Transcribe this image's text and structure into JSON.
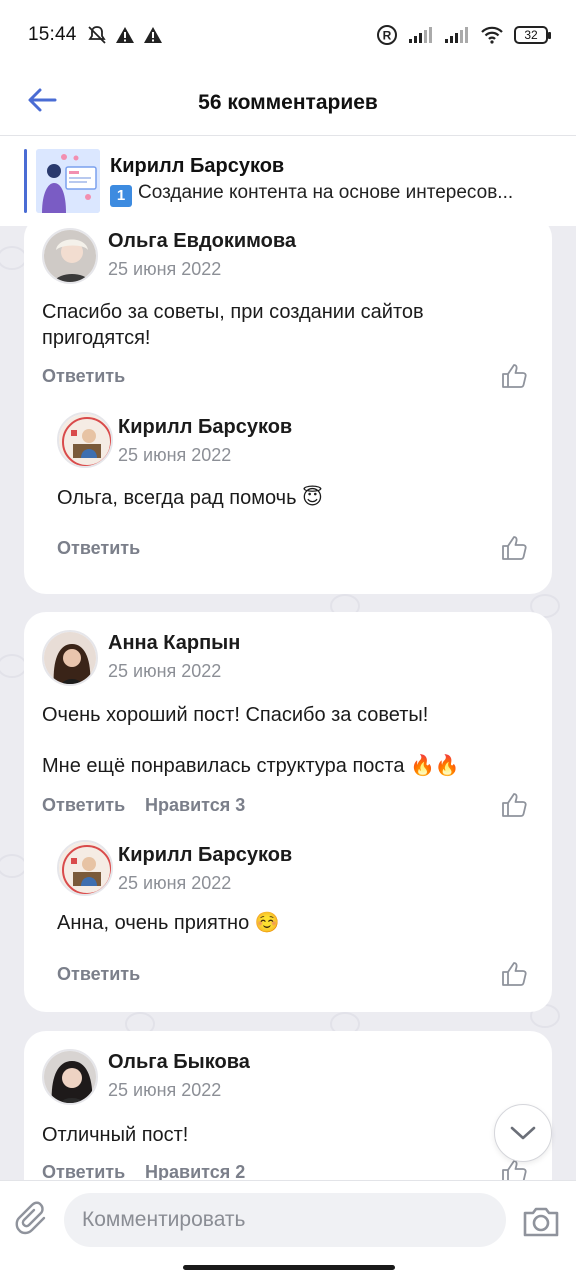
{
  "status_bar": {
    "time": "15:44",
    "battery": "32",
    "icons": [
      "mute-icon",
      "warning-icon",
      "warning-icon",
      "registered-icon",
      "signal-icon",
      "signal-icon",
      "wifi-icon",
      "battery-icon"
    ]
  },
  "header": {
    "title": "56 комментариев",
    "back_icon": "back-arrow-icon"
  },
  "post": {
    "author": "Кирилл Барсуков",
    "badge": "1",
    "snippet": "Создание контента на основе интересов..."
  },
  "threads": [
    {
      "comment": {
        "author": "Ольга Евдокимова",
        "date": "25 июня 2022",
        "text": "Спасибо за советы, при создании сайтов пригодятся!",
        "reply_label": "Ответить"
      },
      "reply": {
        "author": "Кирилл Барсуков",
        "date": "25 июня 2022",
        "text": "Ольга, всегда рад помочь 😇",
        "reply_label": "Ответить"
      }
    },
    {
      "comment": {
        "author": "Анна Карпын",
        "date": "25 июня 2022",
        "text_line1": "Очень хороший пост! Спасибо за советы!",
        "text_line2": "Мне ещё понравилась структура поста 🔥🔥",
        "reply_label": "Ответить",
        "likes": "Нравится 3"
      },
      "reply": {
        "author": "Кирилл Барсуков",
        "date": "25 июня 2022",
        "text": "Анна, очень приятно ☺️",
        "reply_label": "Ответить"
      }
    },
    {
      "comment": {
        "author": "Ольга Быкова",
        "date": "25 июня 2022",
        "text": "Отличный пост!",
        "reply_label": "Ответить",
        "likes": "Нравится 2"
      }
    }
  ],
  "compose": {
    "placeholder": "Комментировать"
  },
  "colors": {
    "accent": "#4a6cd4",
    "feed_bg": "#ececf1",
    "muted": "#7b7f8a"
  }
}
